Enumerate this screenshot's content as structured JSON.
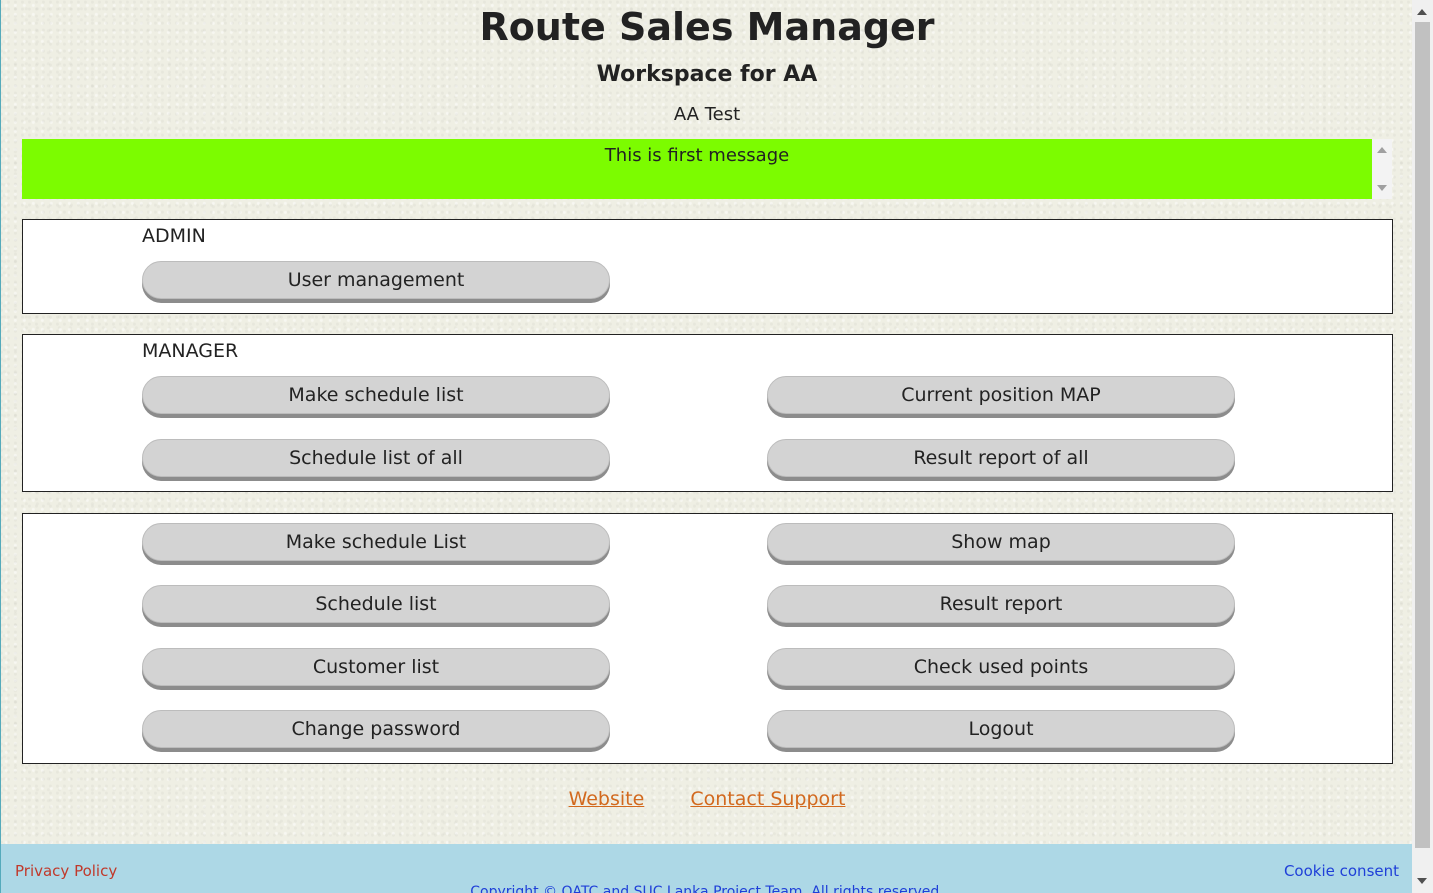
{
  "header": {
    "title": "Route Sales Manager",
    "subtitle": "Workspace for AA",
    "user": "AA Test"
  },
  "message": {
    "text": "This is first message",
    "background": "#7cfc00"
  },
  "admin": {
    "label": "ADMIN",
    "buttons": [
      "User management"
    ]
  },
  "manager": {
    "label": "MANAGER",
    "buttons": [
      "Make schedule list",
      "Current position MAP",
      "Schedule list of all",
      "Result report of all"
    ]
  },
  "user_section": {
    "buttons": [
      "Make schedule List",
      "Show map",
      "Schedule list",
      "Result report",
      "Customer list",
      "Check used points",
      "Change password",
      "Logout"
    ]
  },
  "links": {
    "website": "Website",
    "support": "Contact Support"
  },
  "footer": {
    "privacy": "Privacy Policy",
    "cookie": "Cookie consent",
    "copyright": "Copyright © OATC and SUC Lanka Project Team. All rights reserved."
  },
  "colors": {
    "button_bg": "#d3d3d3",
    "footer_bg": "#add8e6",
    "link": "#d2691e"
  }
}
